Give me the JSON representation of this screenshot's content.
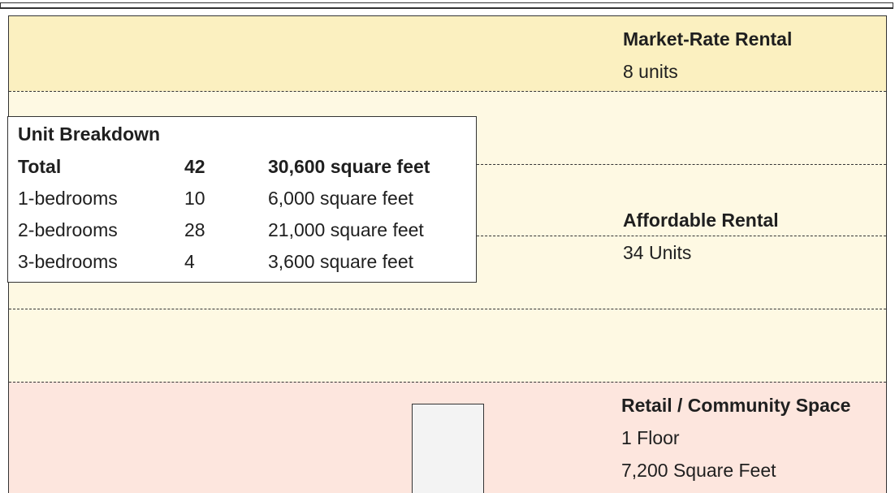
{
  "floors": {
    "market_rate": {
      "title": "Market-Rate Rental",
      "detail": "8 units"
    },
    "affordable": {
      "title": "Affordable Rental",
      "detail": "34 Units"
    },
    "retail": {
      "title": "Retail / Community Space",
      "detail_1": "1 Floor",
      "detail_2": "7,200 Square Feet"
    }
  },
  "unit_breakdown": {
    "title": "Unit Breakdown",
    "rows": [
      {
        "type": "Total",
        "count": "42",
        "area": "30,600 square feet"
      },
      {
        "type": "1-bedrooms",
        "count": "10",
        "area": "6,000 square feet"
      },
      {
        "type": "2-bedrooms",
        "count": "28",
        "area": "21,000 square feet"
      },
      {
        "type": "3-bedrooms",
        "count": "4",
        "area": "3,600 square feet"
      }
    ]
  },
  "colors": {
    "market_rate_fill": "#fbf0c0",
    "affordable_fill": "#fef9e3",
    "retail_fill": "#fde6de",
    "outline": "#333333"
  }
}
